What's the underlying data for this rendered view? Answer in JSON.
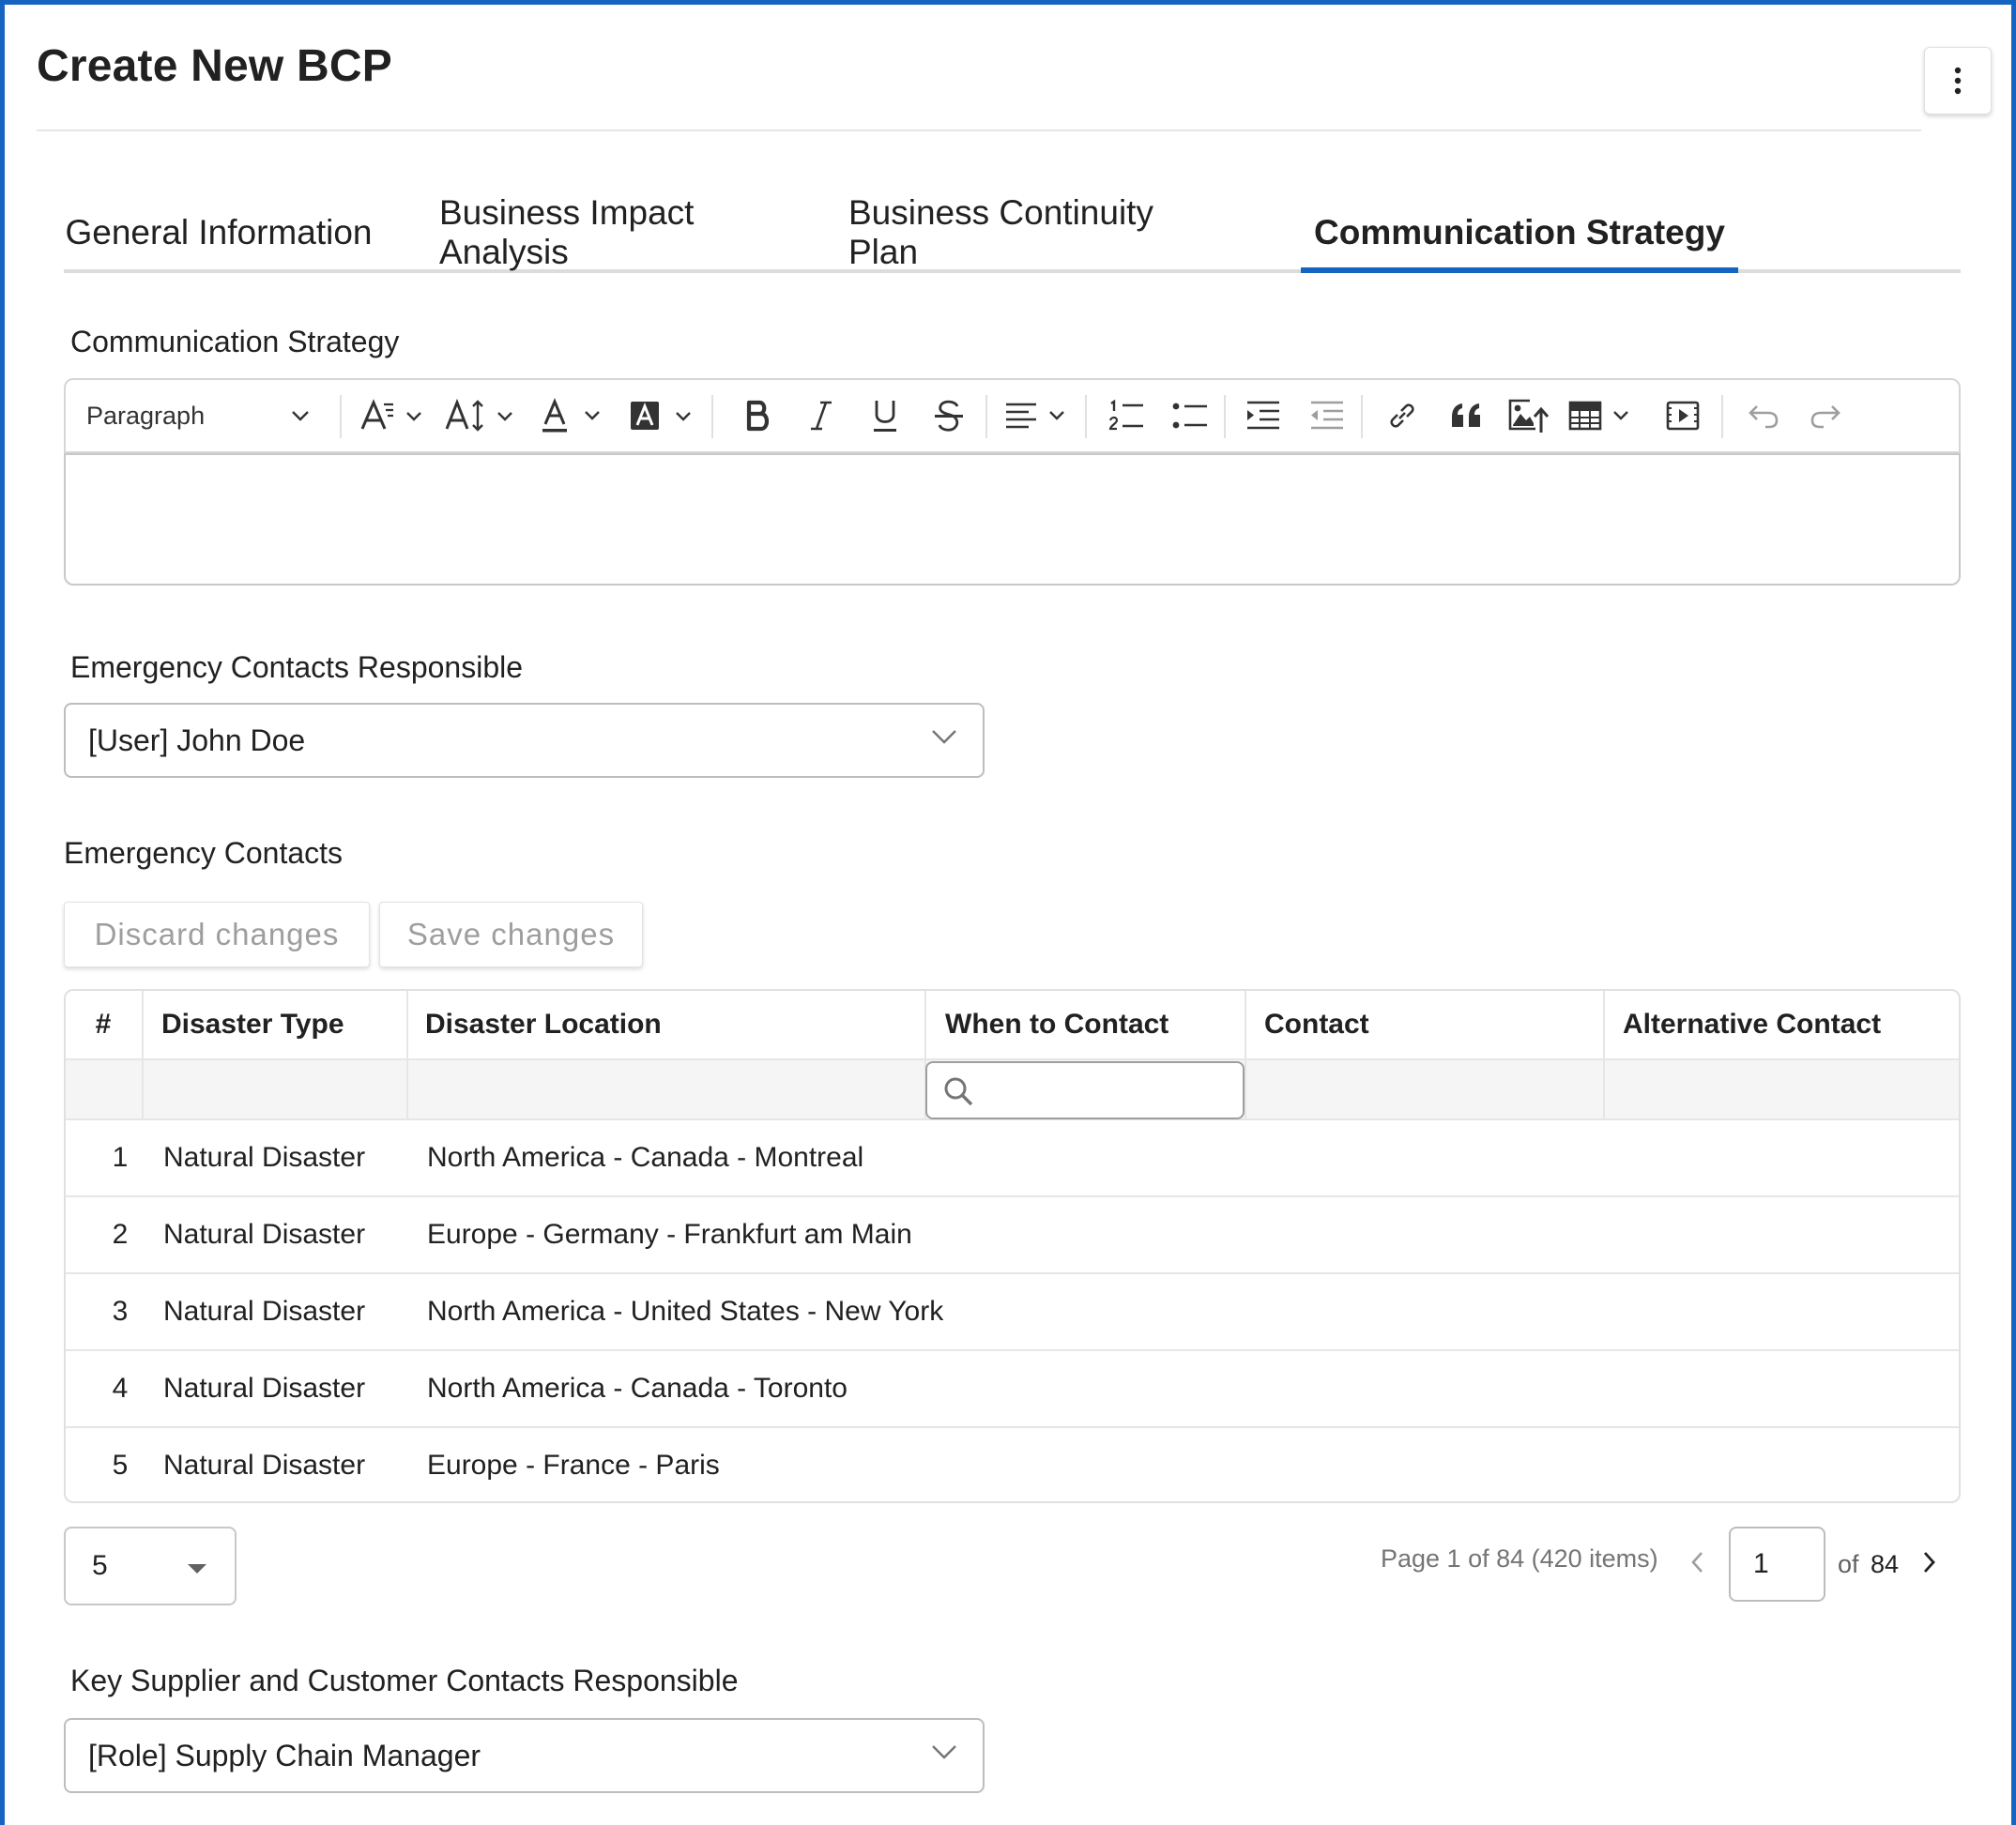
{
  "page": {
    "title": "Create New BCP",
    "menu_icon": "more-vertical-icon"
  },
  "tabs": [
    {
      "label": "General Information",
      "active": false
    },
    {
      "label": "Business Impact Analysis",
      "active": false
    },
    {
      "label": "Business Continuity Plan",
      "active": false
    },
    {
      "label": "Communication Strategy",
      "active": true
    }
  ],
  "colors": {
    "accent": "#1565c0",
    "text": "#212121",
    "disabled_text": "#9e9e9e",
    "border": "#bdbdbd"
  },
  "communication_strategy": {
    "label": "Communication Strategy",
    "toolbar": {
      "paragraph_format": "Paragraph",
      "icons": [
        "font-size-icon",
        "line-height-icon",
        "font-color-icon",
        "highlight-color-icon",
        "bold-icon",
        "italic-icon",
        "underline-icon",
        "strikethrough-icon",
        "align-left-icon",
        "numbered-list-icon",
        "bulleted-list-icon",
        "indent-icon",
        "outdent-icon",
        "link-icon",
        "quote-icon",
        "insert-image-icon",
        "table-icon",
        "media-embed-icon",
        "undo-icon",
        "redo-icon"
      ]
    },
    "content": ""
  },
  "emergency_contacts_responsible": {
    "label": "Emergency Contacts Responsible",
    "value": "[User] John Doe"
  },
  "emergency_contacts": {
    "label": "Emergency Contacts",
    "discard_label": "Discard changes",
    "save_label": "Save changes",
    "columns": [
      "#",
      "Disaster Type",
      "Disaster Location",
      "When to Contact",
      "Contact",
      "Alternative Contact"
    ],
    "filter_placeholder": "",
    "rows": [
      {
        "num": "1",
        "type": "Natural Disaster",
        "location": "North America - Canada - Montreal",
        "when": "",
        "contact": "",
        "alt": ""
      },
      {
        "num": "2",
        "type": "Natural Disaster",
        "location": "Europe - Germany - Frankfurt am Main",
        "when": "",
        "contact": "",
        "alt": ""
      },
      {
        "num": "3",
        "type": "Natural Disaster",
        "location": "North America - United States - New York",
        "when": "",
        "contact": "",
        "alt": ""
      },
      {
        "num": "4",
        "type": "Natural Disaster",
        "location": "North America - Canada - Toronto",
        "when": "",
        "contact": "",
        "alt": ""
      },
      {
        "num": "5",
        "type": "Natural Disaster",
        "location": "Europe - France - Paris",
        "when": "",
        "contact": "",
        "alt": ""
      }
    ],
    "pager": {
      "page_size": "5",
      "info": "Page 1 of 84 (420 items)",
      "current_page": "1",
      "of_label": "of",
      "total_pages": "84"
    }
  },
  "key_supplier_contacts_responsible": {
    "label": "Key Supplier and Customer Contacts Responsible",
    "value": "[Role] Supply Chain Manager"
  }
}
